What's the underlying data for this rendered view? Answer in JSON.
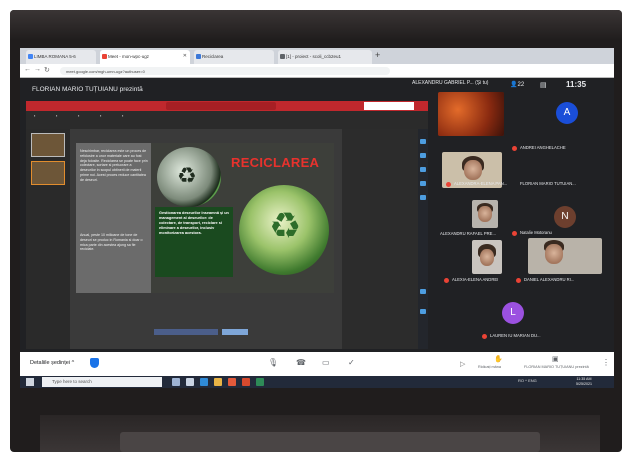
{
  "browser": {
    "tabs": [
      {
        "label": "LIMBA ROMANA 5-6",
        "color": "#4285f4"
      },
      {
        "label": "Meet - mon-wpc-ugz",
        "color": "#ea4335"
      },
      {
        "label": "Reciclarea",
        "color": "#3c78d8"
      },
      {
        "label": "[1] - proiect - scoli_ccb2eu1",
        "color": "#5f6368"
      }
    ],
    "url": "meet.google.com/mgh-umn-ugz?authuser=0"
  },
  "meet": {
    "presenter_title": "FLORIAN MARIO TUȚUIANU prezintă",
    "top_name": "ALEXANDRU GABRIEL P... (Și tu)",
    "people_count": "22",
    "clock": "11:35",
    "slide": {
      "title": "RECICLAREA",
      "left_text_top": "Neschimbar, reciclarea este un proces de refolosire a unor materiale care au fost deja folosite. Reciclarea se poate face prin colectare, sortare si prelucrare a deseurilor in scopul obtinerii de materii prime noi. Acest proces reduce cantitatea de deseuri.",
      "left_text_bottom": "Anual, peste 10 milioane de tone de deseuri se produc in Romania si doar o mica parte din acestea ajung sa fie reciclate.",
      "green_text": "Gestionarea deseurilor înseamnă și un management al deseurilor: de colectare, de transport, reciclare si eliminare a deseurilor, inclusiv monitorizarea acestora."
    },
    "participants": [
      {
        "name": "ANDREI ANGHELACHE",
        "avatar": "A",
        "avatar_color": "#1a4ed8"
      },
      {
        "name": "ALEXANDRA-ELENA PAN..."
      },
      {
        "name": "FLORIAN MARIO TUTUIAN..."
      },
      {
        "name": "ALEXANDRU RAFAEL PRE..."
      },
      {
        "name": "Natalie Motoranu",
        "avatar": "N",
        "avatar_color": "#6d3f2e"
      },
      {
        "name": "ALEXIA-ELENA ANDREI"
      },
      {
        "name": "DANIEL ALEXANDRU RI..."
      },
      {
        "name": "LAUREN IU MARIAN DU...",
        "avatar": "L",
        "avatar_color": "#9b51e0"
      }
    ],
    "bottom": {
      "details_label": "Detaliile ședinței",
      "present_label": "Ridicați mâna",
      "presenter_label": "FLORIAN MARIO TUȚUIANU prezintă"
    }
  },
  "taskbar": {
    "search_placeholder": "Type here to search",
    "tray_text": "RO ^ ENG",
    "time": "11:35 AM",
    "date": "5/25/2021"
  }
}
